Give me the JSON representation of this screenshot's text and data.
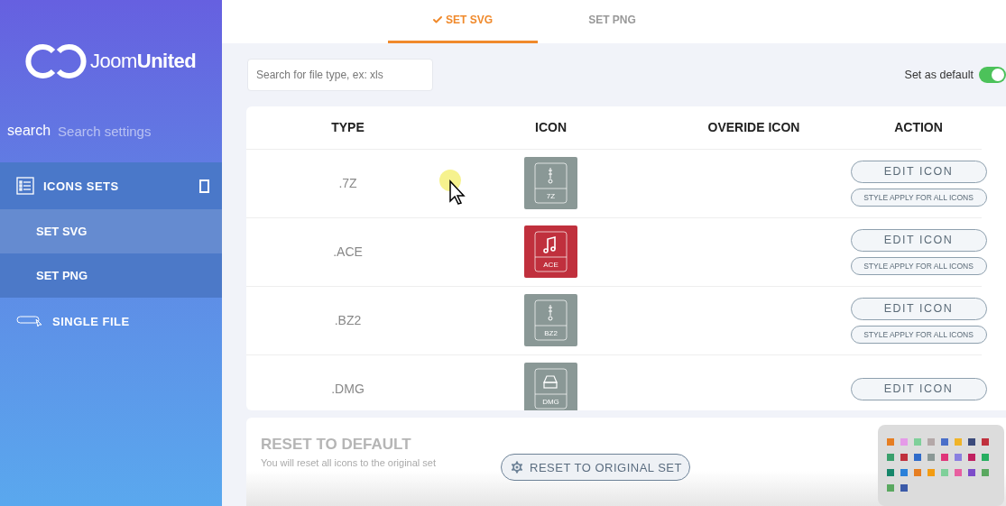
{
  "sidebar": {
    "logo": "Joom**United**",
    "search": {
      "icon_text": "search",
      "placeholder": "Search settings"
    },
    "menu": [
      {
        "label": "ICONS SETS",
        "kind": "list",
        "expanded": true,
        "children": [
          {
            "label": "SET SVG",
            "selected": true
          },
          {
            "label": "SET PNG",
            "selected": false
          }
        ]
      },
      {
        "label": "SINGLE FILE",
        "kind": "mouse",
        "expanded": false
      }
    ]
  },
  "tabs": [
    {
      "label": "SET SVG",
      "selected": true
    },
    {
      "label": "SET PNG",
      "selected": false
    }
  ],
  "search": {
    "placeholder": "Search for file type, ex: xls"
  },
  "default_toggle": {
    "label": "Set as default",
    "on": true
  },
  "table": {
    "columns": [
      "TYPE",
      "ICON",
      "OVERIDE ICON",
      "ACTION"
    ],
    "rows": [
      {
        "type": ".7Z",
        "icon_label": "7Z",
        "kind": "zip",
        "color": "#8a9896",
        "edit_label": "EDIT ICON",
        "style_label": "STYLE APPLY FOR ALL ICONS"
      },
      {
        "type": ".ACE",
        "icon_label": "ACE",
        "kind": "music",
        "color": "#c0303d",
        "edit_label": "EDIT ICON",
        "style_label": "STYLE APPLY FOR ALL ICONS"
      },
      {
        "type": ".BZ2",
        "icon_label": "BZ2",
        "kind": "zip",
        "color": "#8a9896",
        "edit_label": "EDIT ICON",
        "style_label": "STYLE APPLY FOR ALL ICONS"
      },
      {
        "type": ".DMG",
        "icon_label": "DMG",
        "kind": "drive",
        "color": "#8a9896",
        "edit_label": "EDIT ICON"
      }
    ]
  },
  "reset": {
    "title": "RESET TO DEFAULT",
    "description": "You will reset all icons to the original set",
    "button": "RESET TO ORIGINAL SET"
  }
}
